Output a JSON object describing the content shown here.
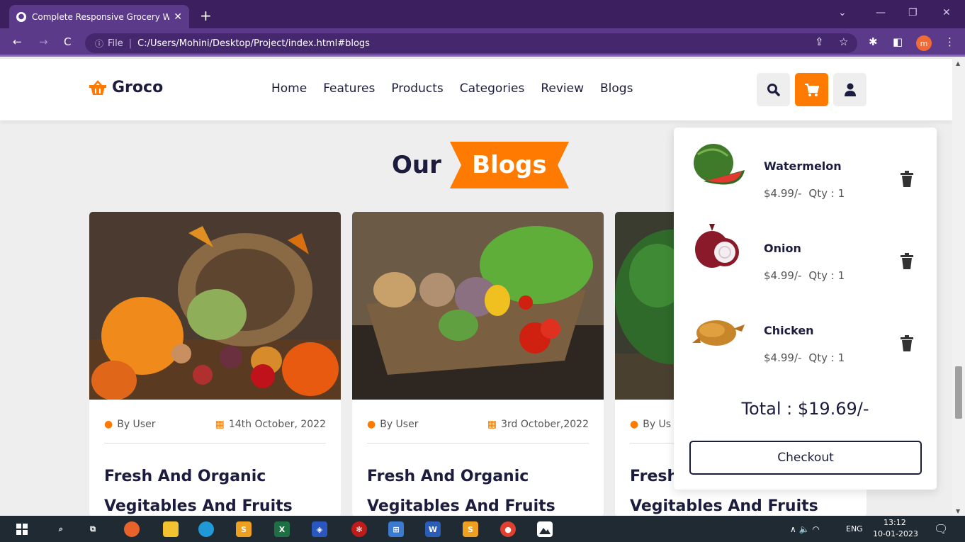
{
  "browser": {
    "tab_title": "Complete Responsive Grocery W",
    "url_prefix": "File",
    "url": "C:/Users/Mohini/Desktop/Project/index.html#blogs",
    "profile_initial": "m"
  },
  "site": {
    "logo": "Groco",
    "nav": [
      "Home",
      "Features",
      "Products",
      "Categories",
      "Review",
      "Blogs"
    ]
  },
  "heading": {
    "first": "Our",
    "second": "Blogs"
  },
  "blogs": [
    {
      "author": "By User",
      "date": "14th October, 2022",
      "title_line1": "Fresh And Organic",
      "title_line2": "Vegitables And Fruits"
    },
    {
      "author": "By User",
      "date": "3rd October,2022",
      "title_line1": "Fresh And Organic",
      "title_line2": "Vegitables And Fruits"
    },
    {
      "author": "By Us",
      "date": "",
      "title_line1": "Fresh",
      "title_line2": "Vegitables And Fruits"
    }
  ],
  "cart": {
    "items": [
      {
        "name": "Watermelon",
        "price": "$4.99/-",
        "qty": "Qty : 1"
      },
      {
        "name": "Onion",
        "price": "$4.99/-",
        "qty": "Qty : 1"
      },
      {
        "name": "Chicken",
        "price": "$4.99/-",
        "qty": "Qty : 1"
      }
    ],
    "total": "Total : $19.69/-",
    "checkout_label": "Checkout"
  },
  "taskbar": {
    "lang": "ENG",
    "time": "13:12",
    "date": "10-01-2023"
  },
  "colors": {
    "accent": "#ff7a00",
    "dark": "#1c1d3e",
    "chrome": "#5b3a8a"
  }
}
